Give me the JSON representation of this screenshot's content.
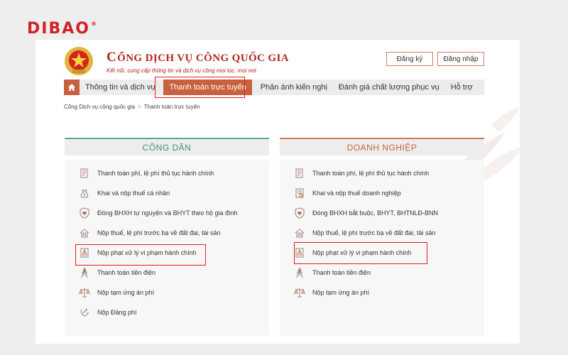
{
  "brand": {
    "logo_text": "DIBAO",
    "reg_mark": "®"
  },
  "header": {
    "title": "CỔNG DỊCH VỤ CÔNG QUỐC GIA",
    "title_first_letter": "C",
    "title_rest": "ỔNG DỊCH VỤ CÔNG QUỐC GIA",
    "subtitle": "Kết nối, cung cấp thông tin và dịch vụ công mọi lúc, mọi nơi",
    "register_label": "Đăng ký",
    "login_label": "Đăng nhập"
  },
  "nav": {
    "items": [
      {
        "label": "Thông tin và dịch vụ"
      },
      {
        "label": "Thanh toán trực tuyến"
      },
      {
        "label": "Phản ánh kiến nghị"
      },
      {
        "label": "Đánh giá chất lượng phục vụ"
      },
      {
        "label": "Hỗ trợ"
      }
    ],
    "active_index": 1
  },
  "breadcrumb": {
    "items": [
      "Cổng Dịch vụ công quốc gia",
      "Thanh toán trực tuyến"
    ],
    "separator": ">"
  },
  "citizen": {
    "heading": "CÔNG DÂN",
    "items": [
      "Thanh toán phí, lệ phí thủ tục hành chính",
      "Khai và nộp thuế cá nhân",
      "Đóng BHXH tự nguyện và BHYT theo hộ gia đình",
      "Nộp thuế, lệ phí trước bạ về đất đai, tài sản",
      "Nộp phạt xử lý vi phạm hành chính",
      "Thanh toán tiền điện",
      "Nộp tạm ứng án phí",
      "Nộp Đảng phí"
    ]
  },
  "business": {
    "heading": "DOANH NGHIỆP",
    "items": [
      "Thanh toán phí, lệ phí thủ tục hành chính",
      "Khai và nộp thuế doanh nghiệp",
      "Đóng BHXH bắt buộc, BHYT, BHTNLĐ-BNN",
      "Nộp thuế, lệ phí trước bạ về đất đai, tài sản",
      "Nộp phạt xử lý vi phạm hành chính",
      "Thanh toán tiền điện",
      "Nộp tạm ứng án phí"
    ]
  },
  "colors": {
    "brand_red": "#d22027",
    "nav_active": "#c8613f",
    "citizen_accent": "#3f8f85",
    "business_accent": "#c8613f",
    "highlight_red": "#e0201f"
  }
}
